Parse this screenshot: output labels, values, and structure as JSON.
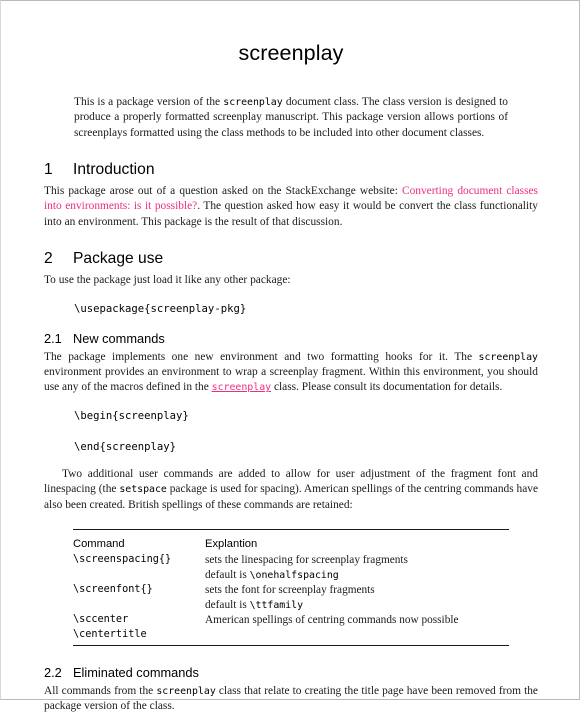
{
  "document": {
    "title": "screenplay",
    "abstract": {
      "part1": "This is a package version of the ",
      "code1": "screenplay",
      "part2": " document class. The class version is designed to produce a properly formatted screenplay manuscript. This package version allows portions of screenplays formatted using the class methods to be included into other document classes."
    },
    "sections": [
      {
        "number": "1",
        "title": "Introduction",
        "paragraph": {
          "part1": "This package arose out of a question asked on the StackExchange website: ",
          "link": "Converting document classes into environments: is it possible?",
          "part2": ". The question asked how easy it would be convert the class functionality into an environment. This package is the result of that discussion."
        }
      },
      {
        "number": "2",
        "title": "Package use",
        "intro": "To use the package just load it like any other package:",
        "code_usepackage": "\\usepackage{screenplay-pkg}",
        "subsections": [
          {
            "number": "2.1",
            "title": "New commands",
            "paragraph": {
              "part1": "The package implements one new environment and two formatting hooks for it. The ",
              "code1": "screenplay",
              "part2": " environment provides an environment to wrap a screenplay fragment. Within this environment, you should use any of the macros defined in the ",
              "link_code": "screenplay",
              "part3": " class. Please consult its documentation for details."
            },
            "code_begin": "\\begin{screenplay}",
            "code_end": "\\end{screenplay}",
            "paragraph2": {
              "part1": "Two additional user commands are added to allow for user adjustment of the fragment font and linespacing (the ",
              "code1": "setspace",
              "part2": " package is used for spacing). American spellings of the centring commands have also been created. British spellings of these commands are retained:"
            },
            "table": {
              "headers": [
                "Command",
                "Explantion"
              ],
              "rows": [
                {
                  "command": "\\screenspacing{}",
                  "explanation_main": "sets the linespacing for screenplay fragments",
                  "explanation_sub_prefix": "default is ",
                  "explanation_sub_code": "\\onehalfspacing"
                },
                {
                  "command": "\\screenfont{}",
                  "explanation_main": "sets the font for screenplay fragments",
                  "explanation_sub_prefix": "default is ",
                  "explanation_sub_code": "\\ttfamily"
                },
                {
                  "command": "\\sccenter",
                  "command2": "\\centertitle",
                  "explanation_main": "American spellings of centring commands now possible"
                }
              ]
            }
          },
          {
            "number": "2.2",
            "title": "Eliminated commands",
            "paragraph": {
              "part1": "All commands from the ",
              "code1": "screenplay",
              "part2": " class that relate to creating the title page have been removed from the package version of the class."
            }
          }
        ]
      }
    ]
  },
  "colors": {
    "link": "#ee2d82",
    "text": "#1a1a1a",
    "page_border": "#b9b9b9"
  }
}
